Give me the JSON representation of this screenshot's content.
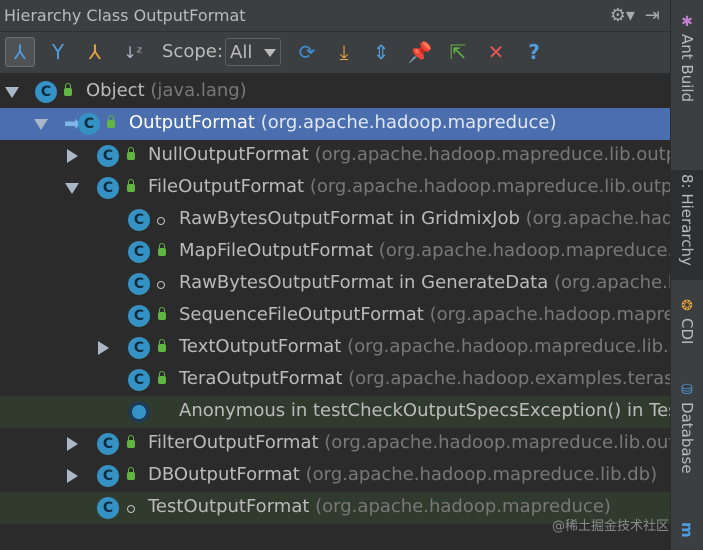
{
  "titlebar": {
    "title": "Hierarchy Class OutputFormat",
    "gear_icon": "gear-icon",
    "hide_icon": "hide-panel-icon"
  },
  "toolbar": {
    "scope_label": "Scope:",
    "scope_value": "All",
    "buttons": [
      "type-hierarchy-icon",
      "supertypes-icon",
      "subtypes-icon",
      "sort-alpha-icon",
      "refresh-icon",
      "export-icon",
      "expand-all-icon",
      "pin-icon",
      "navigate-icon",
      "close-icon",
      "help-icon"
    ]
  },
  "tree": {
    "rows": [
      {
        "name": "Object",
        "pkg": "(java.lang)"
      },
      {
        "name": "OutputFormat",
        "pkg": "(org.apache.hadoop.mapreduce)"
      },
      {
        "name": "NullOutputFormat",
        "pkg": "(org.apache.hadoop.mapreduce.lib.output)"
      },
      {
        "name": "FileOutputFormat",
        "pkg": "(org.apache.hadoop.mapreduce.lib.output)"
      },
      {
        "name": "RawBytesOutputFormat in GridmixJob",
        "pkg": "(org.apache.hadoop"
      },
      {
        "name": "MapFileOutputFormat",
        "pkg": "(org.apache.hadoop.mapreduce.li"
      },
      {
        "name": "RawBytesOutputFormat in GenerateData",
        "pkg": "(org.apache.hadoo"
      },
      {
        "name": "SequenceFileOutputFormat",
        "pkg": "(org.apache.hadoop.mapreduce"
      },
      {
        "name": "TextOutputFormat",
        "pkg": "(org.apache.hadoop.mapreduce.lib.ou"
      },
      {
        "name": "TeraOutputFormat",
        "pkg": "(org.apache.hadoop.examples.terasor"
      },
      {
        "name": "Anonymous in testCheckOutputSpecsException() in TestF",
        "pkg": ""
      },
      {
        "name": "FilterOutputFormat",
        "pkg": "(org.apache.hadoop.mapreduce.lib.outp"
      },
      {
        "name": "DBOutputFormat",
        "pkg": "(org.apache.hadoop.mapreduce.lib.db)"
      },
      {
        "name": "TestOutputFormat",
        "pkg": "(org.apache.hadoop.mapreduce)"
      }
    ]
  },
  "sidebar": {
    "tabs": [
      "Ant Build",
      "8: Hierarchy",
      "CDI",
      "Database",
      "m"
    ]
  },
  "watermark": "@稀土掘金技术社区",
  "colors": {
    "selection": "#4b6eaf",
    "class_icon": "#3592c4",
    "package_text": "#787878",
    "highlight_row": "#303a2d"
  }
}
